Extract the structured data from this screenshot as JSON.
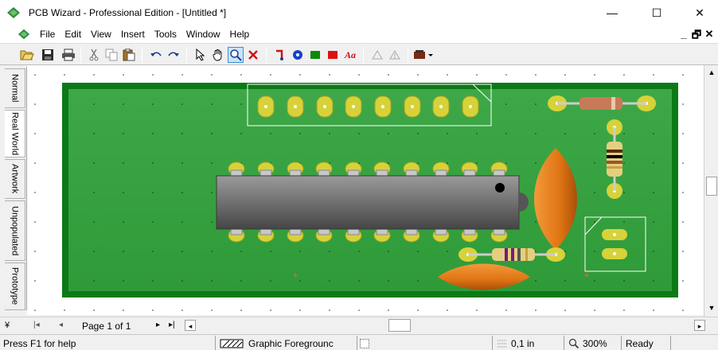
{
  "window": {
    "title": "PCB Wizard - Professional Edition - [Untitled *]"
  },
  "window_controls": {
    "minimize": "—",
    "maximize": "☐",
    "close": "✕"
  },
  "menu": {
    "items": [
      "File",
      "Edit",
      "View",
      "Insert",
      "Tools",
      "Window",
      "Help"
    ]
  },
  "mdi_controls": [
    "_",
    "🗗",
    "✕"
  ],
  "toolbar": {
    "buttons": [
      "open-icon",
      "save-icon",
      "print-icon",
      "cut-icon",
      "copy-icon",
      "paste-icon",
      "undo-icon",
      "redo-icon",
      "select-pointer-icon",
      "pan-hand-icon",
      "zoom-icon",
      "delete-icon",
      "track-icon",
      "pad-icon",
      "green-rectangle-icon",
      "red-rectangle-icon",
      "text-icon",
      "rotate-left-icon",
      "rotate-right-icon",
      "component-dropdown-icon"
    ],
    "text_tool_label": "Aa"
  },
  "side_tabs": [
    "Normal",
    "Real World",
    "Artwork",
    "Unpopulated",
    "Prototype"
  ],
  "active_tab": "Real World",
  "page_nav": {
    "label": "Page 1 of 1"
  },
  "status": {
    "help": "Press F1 for help",
    "layer": "Graphic Foregrounc",
    "grid": "0,1 in",
    "zoom": "300%",
    "state": "Ready"
  },
  "colors": {
    "board": "#2f9a38",
    "board_border": "#0b7a16",
    "pad": "#c9c936",
    "chip": "#6e6e6e",
    "capacitor": "#e8821f"
  }
}
